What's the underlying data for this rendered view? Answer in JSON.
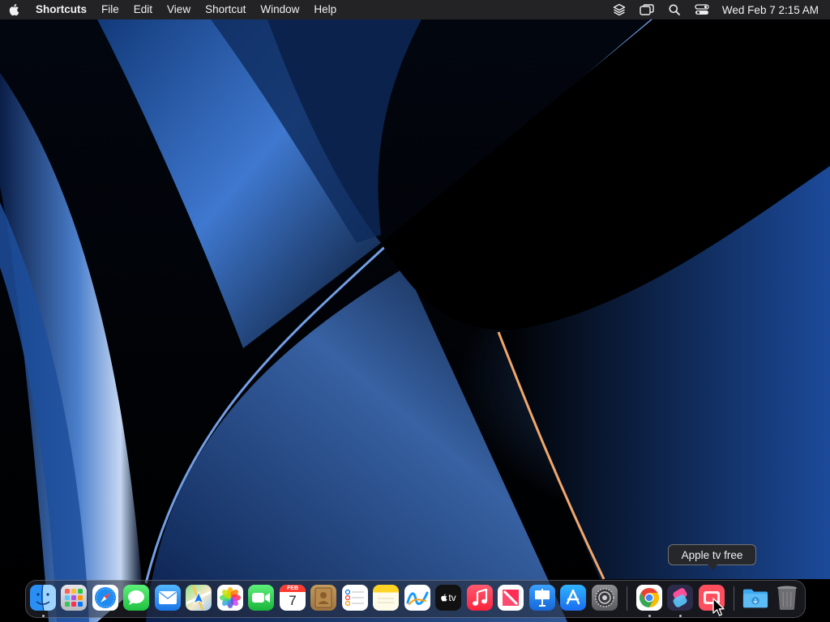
{
  "menubar": {
    "apple_icon": "apple-logo-icon",
    "app_name": "Shortcuts",
    "menus": [
      "File",
      "Edit",
      "View",
      "Shortcut",
      "Window",
      "Help"
    ],
    "status_icons": [
      "stack-icon",
      "screen-mirroring-icon",
      "search-icon",
      "control-center-icon"
    ],
    "clock": "Wed Feb 7  2:15 AM"
  },
  "tooltip": {
    "label": "Apple tv free"
  },
  "dock": {
    "apps": [
      {
        "name": "Finder",
        "icon": "finder-icon",
        "running": true
      },
      {
        "name": "Launchpad",
        "icon": "launchpad-icon",
        "running": false
      },
      {
        "name": "Safari",
        "icon": "safari-icon",
        "running": false
      },
      {
        "name": "Messages",
        "icon": "messages-icon",
        "running": false
      },
      {
        "name": "Mail",
        "icon": "mail-icon",
        "running": false
      },
      {
        "name": "Maps",
        "icon": "maps-icon",
        "running": false
      },
      {
        "name": "Photos",
        "icon": "photos-icon",
        "running": false
      },
      {
        "name": "FaceTime",
        "icon": "facetime-icon",
        "running": false
      },
      {
        "name": "Calendar",
        "icon": "calendar-icon",
        "running": false,
        "month": "FEB",
        "day": "7"
      },
      {
        "name": "Contacts",
        "icon": "contacts-icon",
        "running": false
      },
      {
        "name": "Reminders",
        "icon": "reminders-icon",
        "running": false
      },
      {
        "name": "Notes",
        "icon": "notes-icon",
        "running": false
      },
      {
        "name": "Freeform",
        "icon": "freeform-icon",
        "running": false
      },
      {
        "name": "TV",
        "icon": "apple-tv-icon",
        "running": false,
        "label": "tv"
      },
      {
        "name": "Music",
        "icon": "music-icon",
        "running": false
      },
      {
        "name": "News",
        "icon": "news-icon",
        "running": false
      },
      {
        "name": "Keynote",
        "icon": "keynote-icon",
        "running": false
      },
      {
        "name": "App Store",
        "icon": "app-store-icon",
        "running": false
      },
      {
        "name": "System Settings",
        "icon": "system-settings-icon",
        "running": false
      }
    ],
    "recent_apps": [
      {
        "name": "Google Chrome",
        "icon": "chrome-icon",
        "running": true
      },
      {
        "name": "Shortcuts",
        "icon": "shortcuts-icon",
        "running": true
      },
      {
        "name": "Apple tv free",
        "icon": "apple-tv-free-icon",
        "running": false
      }
    ],
    "stacks": [
      {
        "name": "Downloads",
        "icon": "downloads-folder-icon"
      },
      {
        "name": "Trash",
        "icon": "trash-icon"
      }
    ]
  }
}
